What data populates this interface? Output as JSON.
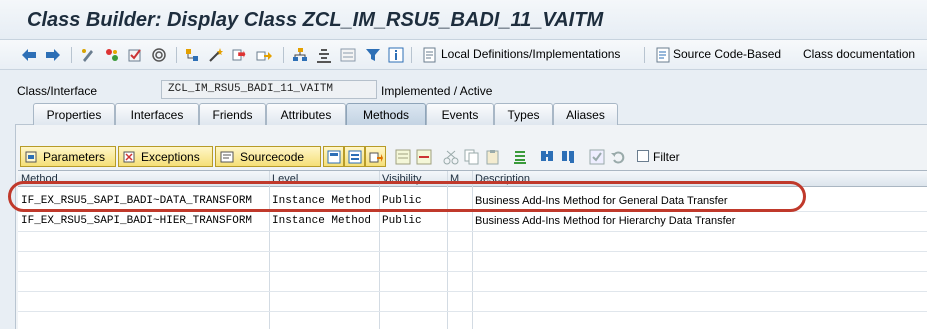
{
  "window": {
    "title": "Class Builder: Display Class ZCL_IM_RSU5_BADI_11_VAITM"
  },
  "toolbar": {
    "local_defs_label": "Local Definitions/Implementations",
    "source_code_label": "Source Code-Based",
    "class_doc_label": "Class documentation"
  },
  "class_field": {
    "label": "Class/Interface",
    "value": "ZCL_IM_RSU5_BADI_11_VAITM",
    "status": "Implemented / Active"
  },
  "tabs": [
    "Properties",
    "Interfaces",
    "Friends",
    "Attributes",
    "Methods",
    "Events",
    "Types",
    "Aliases"
  ],
  "active_tab": "Methods",
  "methods_toolbar": {
    "parameters_label": "Parameters",
    "exceptions_label": "Exceptions",
    "sourcecode_label": "Sourcecode",
    "filter_label": "Filter"
  },
  "grid": {
    "columns": [
      "Method",
      "Level",
      "Visibility",
      "M",
      "Description"
    ],
    "rows": [
      {
        "method": "IF_EX_RSU5_SAPI_BADI~DATA_TRANSFORM",
        "level": "Instance Method",
        "visibility": "Public",
        "m": "",
        "description": "Business Add-Ins Method for General Data Transfer"
      },
      {
        "method": "IF_EX_RSU5_SAPI_BADI~HIER_TRANSFORM",
        "level": "Instance Method",
        "visibility": "Public",
        "m": "",
        "description": "Business Add-Ins Method for Hierarchy Data Transfer"
      }
    ]
  },
  "colors": {
    "highlight": "#c0392b",
    "button": "#f5df78",
    "active_tab": "#c3d3e3"
  }
}
